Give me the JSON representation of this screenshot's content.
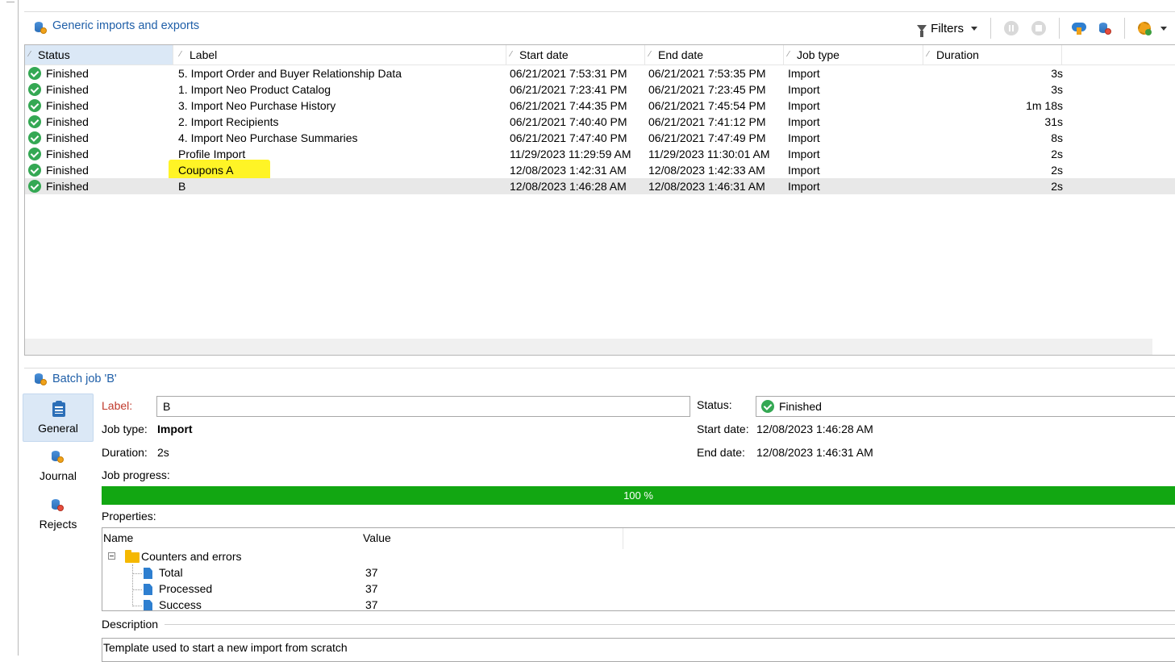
{
  "top_panel": {
    "title": "Generic imports and exports",
    "filters_label": "Filters"
  },
  "columns": {
    "status": "Status",
    "label": "Label",
    "start_date": "Start date",
    "end_date": "End date",
    "job_type": "Job type",
    "duration": "Duration"
  },
  "rows": [
    {
      "status": "Finished",
      "label": "5. Import Order and Buyer Relationship Data",
      "start": "06/21/2021 7:53:31 PM",
      "end": "06/21/2021 7:53:35 PM",
      "type": "Import",
      "duration": "3s"
    },
    {
      "status": "Finished",
      "label": "1. Import Neo Product Catalog",
      "start": "06/21/2021 7:23:41 PM",
      "end": "06/21/2021 7:23:45 PM",
      "type": "Import",
      "duration": "3s"
    },
    {
      "status": "Finished",
      "label": "3. Import Neo Purchase History",
      "start": "06/21/2021 7:44:35 PM",
      "end": "06/21/2021 7:45:54 PM",
      "type": "Import",
      "duration": "1m 18s"
    },
    {
      "status": "Finished",
      "label": "2. Import Recipients",
      "start": "06/21/2021 7:40:40 PM",
      "end": "06/21/2021 7:41:12 PM",
      "type": "Import",
      "duration": "31s"
    },
    {
      "status": "Finished",
      "label": "4. Import Neo Purchase Summaries",
      "start": "06/21/2021 7:47:40 PM",
      "end": "06/21/2021 7:47:49 PM",
      "type": "Import",
      "duration": "8s"
    },
    {
      "status": "Finished",
      "label": "Profile Import",
      "start": "11/29/2023 11:29:59 AM",
      "end": "11/29/2023 11:30:01 AM",
      "type": "Import",
      "duration": "2s"
    },
    {
      "status": "Finished",
      "label": "Coupons A",
      "start": "12/08/2023 1:42:31 AM",
      "end": "12/08/2023 1:42:33 AM",
      "type": "Import",
      "duration": "2s"
    },
    {
      "status": "Finished",
      "label": "B",
      "start": "12/08/2023 1:46:28 AM",
      "end": "12/08/2023 1:46:31 AM",
      "type": "Import",
      "duration": "2s"
    }
  ],
  "detail": {
    "title": "Batch job 'B'",
    "nav": [
      "General",
      "Journal",
      "Rejects"
    ],
    "label_caption": "Label:",
    "label_value": "B",
    "status_caption": "Status:",
    "status_value": "Finished",
    "job_type_caption": "Job type:",
    "job_type_value": "Import",
    "start_caption": "Start date:",
    "start_value": "12/08/2023 1:46:28 AM",
    "duration_caption": "Duration:",
    "duration_value": "2s",
    "end_caption": "End date:",
    "end_value": "12/08/2023 1:46:31 AM",
    "progress_caption": "Job progress:",
    "progress_text": "100 %",
    "progress_fraction": 1.0,
    "properties_caption": "Properties:",
    "prop_name_header": "Name",
    "prop_value_header": "Value",
    "group_label": "Counters and errors",
    "counters": [
      {
        "name": "Total",
        "value": "37"
      },
      {
        "name": "Processed",
        "value": "37"
      },
      {
        "name": "Success",
        "value": "37"
      }
    ],
    "description_caption": "Description",
    "description_value": "Template used to start a new import from scratch"
  }
}
